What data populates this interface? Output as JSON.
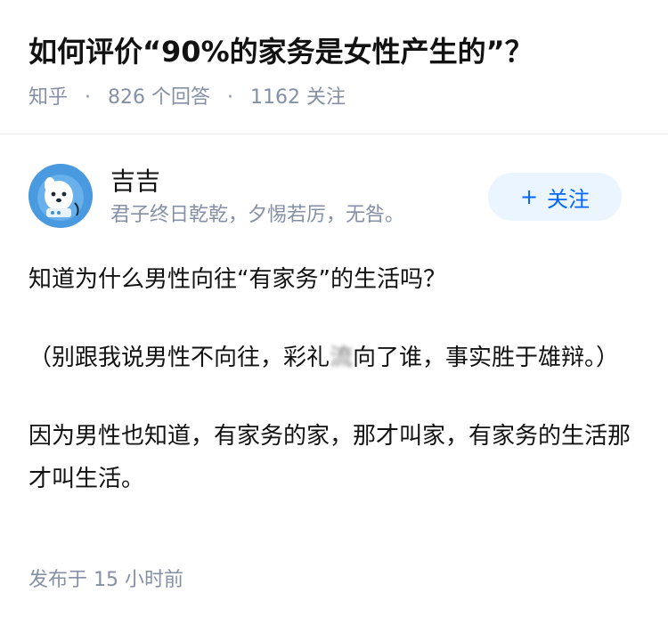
{
  "question": {
    "title": "如何评价“90%的家务是女性产生的”？",
    "source": "知乎",
    "answers_count": "826",
    "answers_label": "个回答",
    "followers_count": "1162",
    "followers_label": "关注"
  },
  "answer": {
    "author": {
      "name": "吉吉",
      "bio": "君子终日乾乾，夕惕若厉，无咎。"
    },
    "follow_button": {
      "icon": "plus-icon",
      "label": "关注"
    },
    "paragraphs": {
      "p1": "知道为什么男性向往“有家务”的生活吗？",
      "p2_before": "（别跟我说男性不向往，彩礼",
      "p2_blurred": "流",
      "p2_after": "向了谁，事实胜于雄辩。）",
      "p3": "因为男性也知道，有家务的家，那才叫家，有家务的生活那才叫生活。"
    },
    "published": {
      "label": "发布于",
      "time": "15 小时前"
    }
  },
  "colors": {
    "title": "#121212",
    "meta": "#8590a6",
    "accent": "#0066ff",
    "follow_bg": "#ebf5ff",
    "avatar_bg": "#3b8fd6"
  }
}
